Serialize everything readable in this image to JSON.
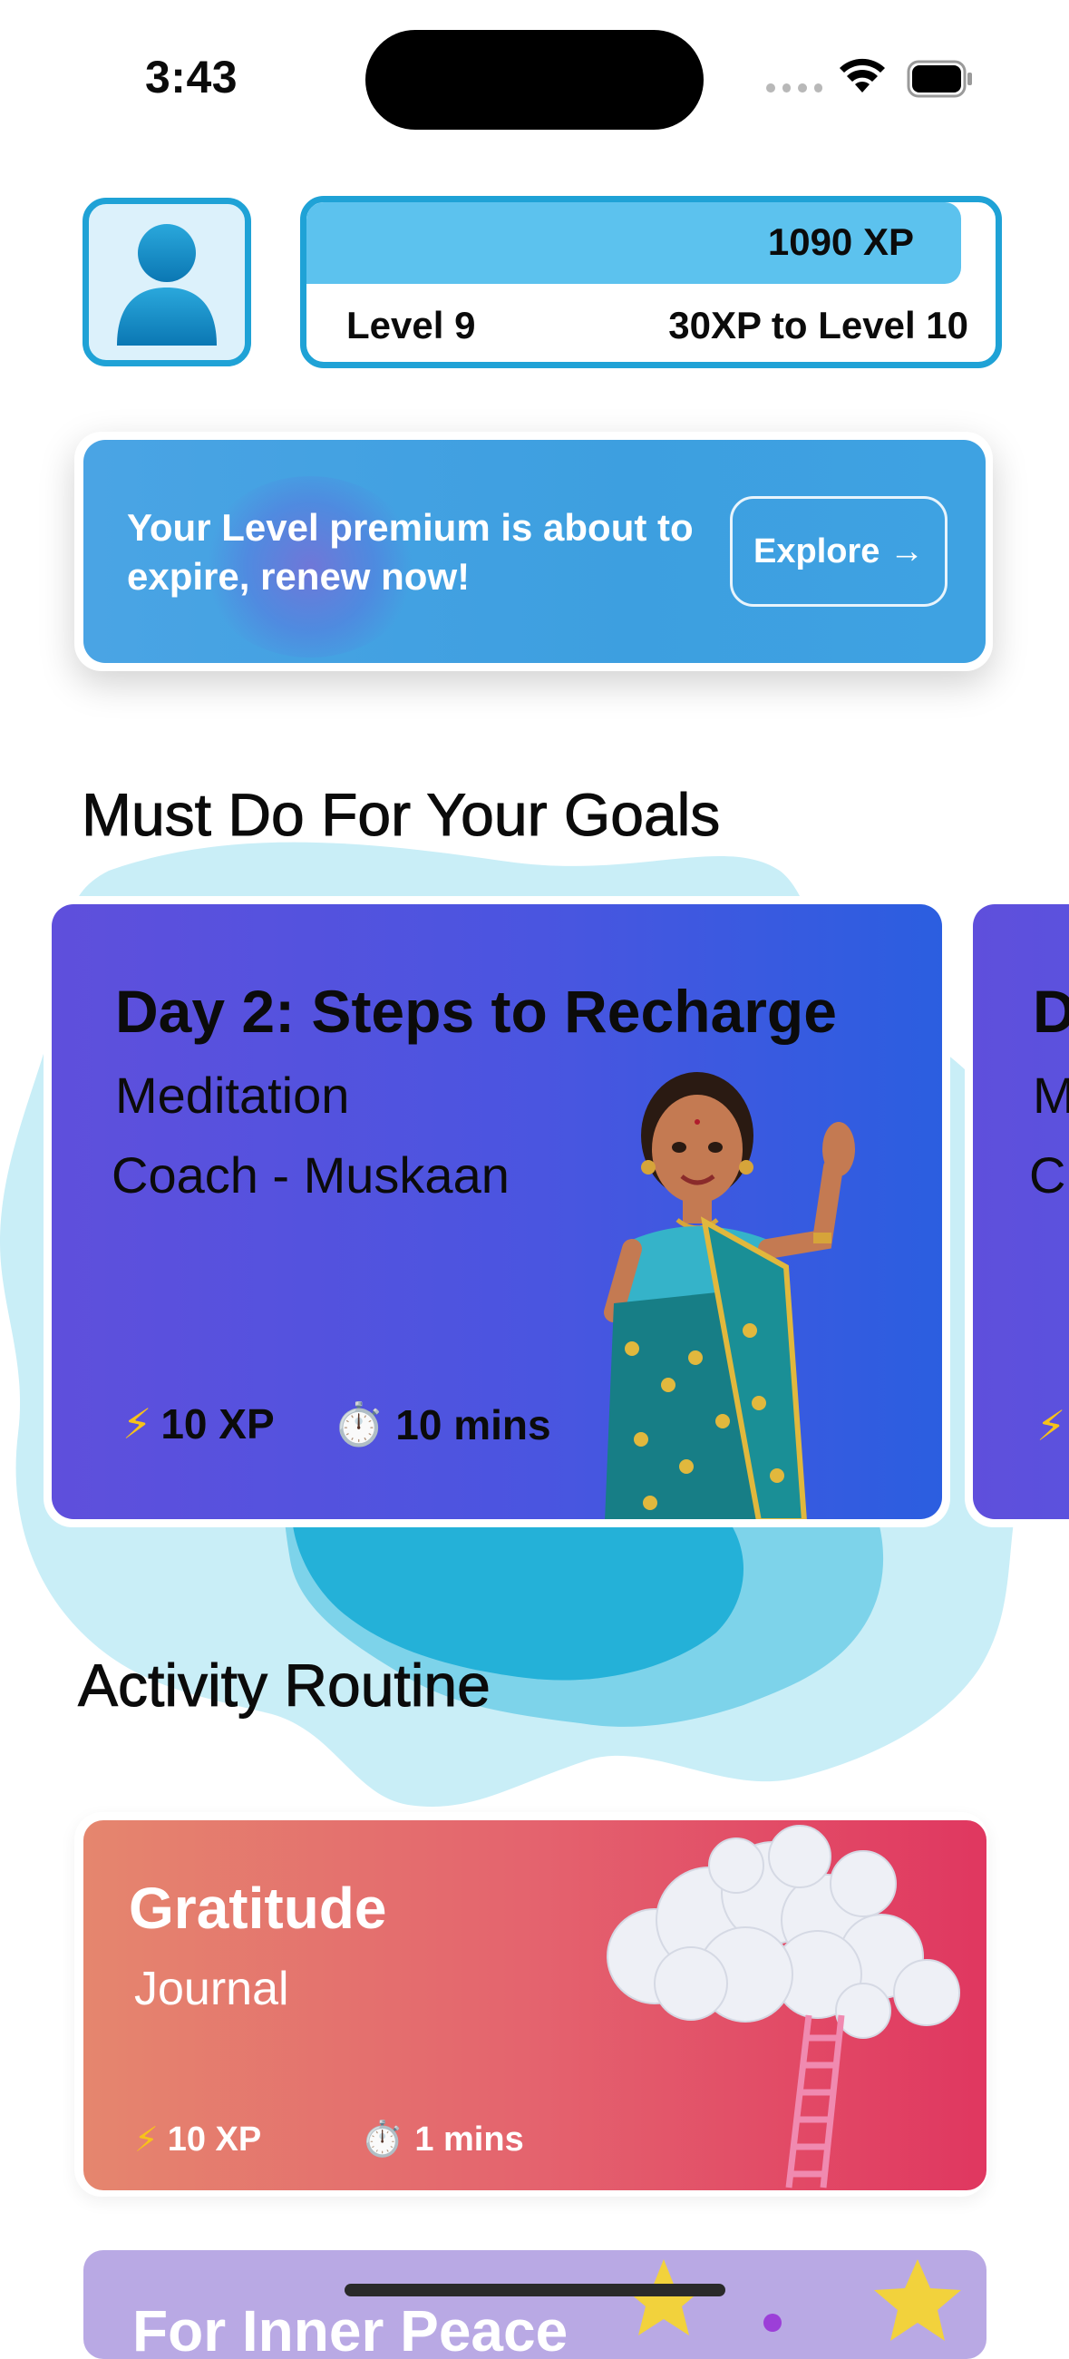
{
  "status_bar": {
    "time": "3:43"
  },
  "header": {
    "xp_value": "1090 XP",
    "xp_progress": 0.95,
    "level": "Level 9",
    "next_level": "30XP to Level 10"
  },
  "banner": {
    "message": "Your Level premium is about to expire, renew now!",
    "button_label": "Explore →"
  },
  "goals": {
    "title": "Must Do For Your Goals",
    "cards": [
      {
        "title": "Day 2: Steps to Recharge",
        "type": "Meditation",
        "coach": "Coach - Muskaan",
        "xp": "10 XP",
        "duration": "10 mins"
      },
      {
        "title": "D",
        "type": "M",
        "coach": "C"
      }
    ]
  },
  "activity": {
    "title": "Activity Routine",
    "cards": [
      {
        "title": "Gratitude",
        "subtitle": "Journal",
        "xp": "10 XP",
        "duration": "1 mins"
      },
      {
        "title": "For Inner Peace"
      }
    ]
  },
  "colors": {
    "accent": "#1fa2d6",
    "xp_fill": "#5cc2ee",
    "banner": "#4aa4e4",
    "goal_card": "#5f4fdc",
    "activity_card": "#e4636e"
  }
}
